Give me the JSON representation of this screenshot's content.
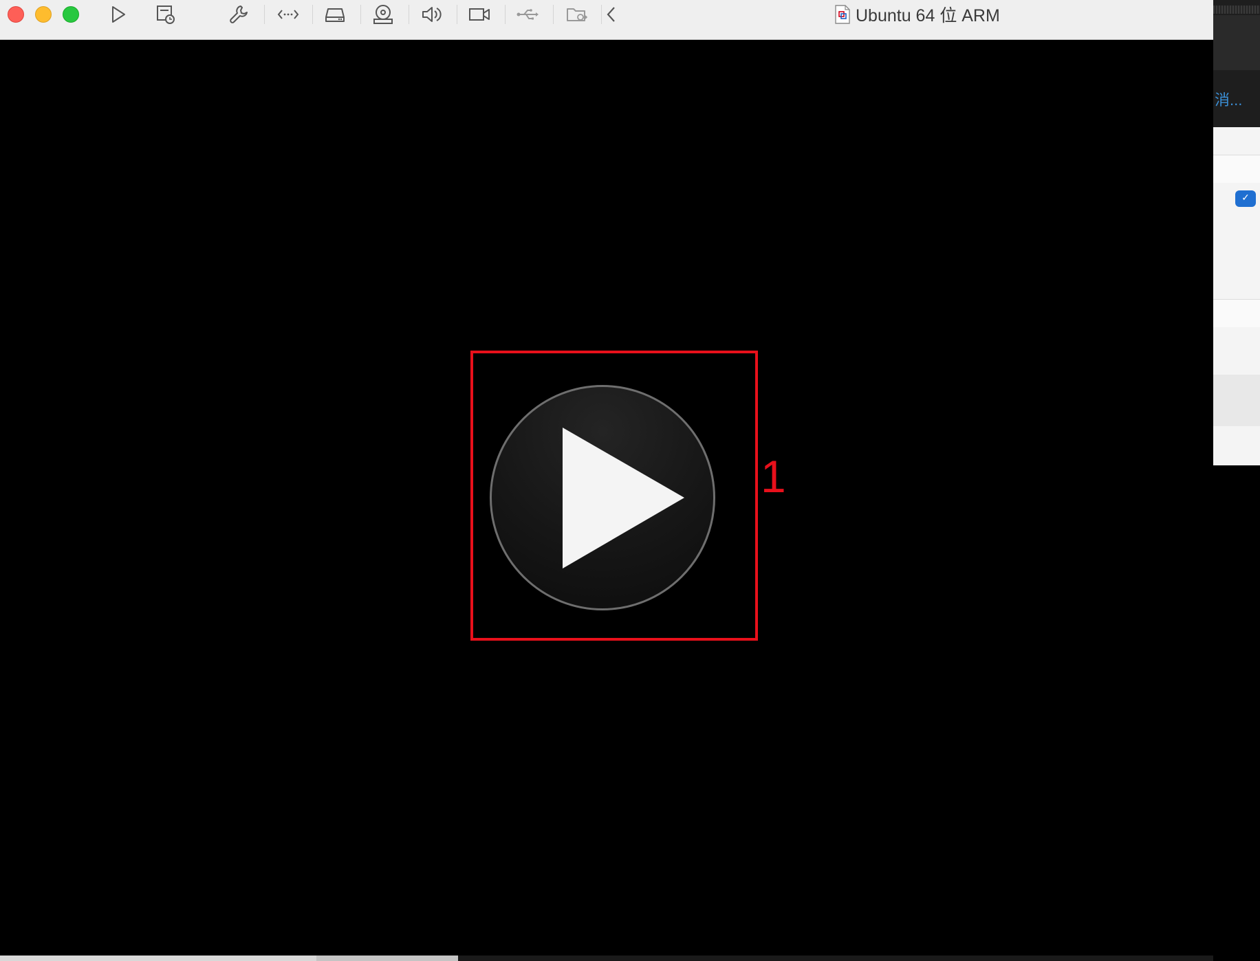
{
  "window": {
    "title": "Ubuntu 64 位 ARM"
  },
  "toolbar": {
    "icons": [
      "play-icon",
      "snapshot-icon",
      "wrench-icon",
      "network-icon",
      "hard-disk-icon",
      "cd-drive-icon",
      "sound-icon",
      "camera-icon",
      "usb-icon",
      "shared-folder-icon",
      "chevron-left-icon"
    ]
  },
  "background_app": {
    "link_text": "消..."
  },
  "annotation": {
    "label": "1",
    "color": "#e8101b"
  },
  "colors": {
    "close": "#fe5f57",
    "minimize": "#febc2e",
    "maximize": "#28c840",
    "vm_screen": "#000000",
    "titlebar": "#efefef"
  }
}
